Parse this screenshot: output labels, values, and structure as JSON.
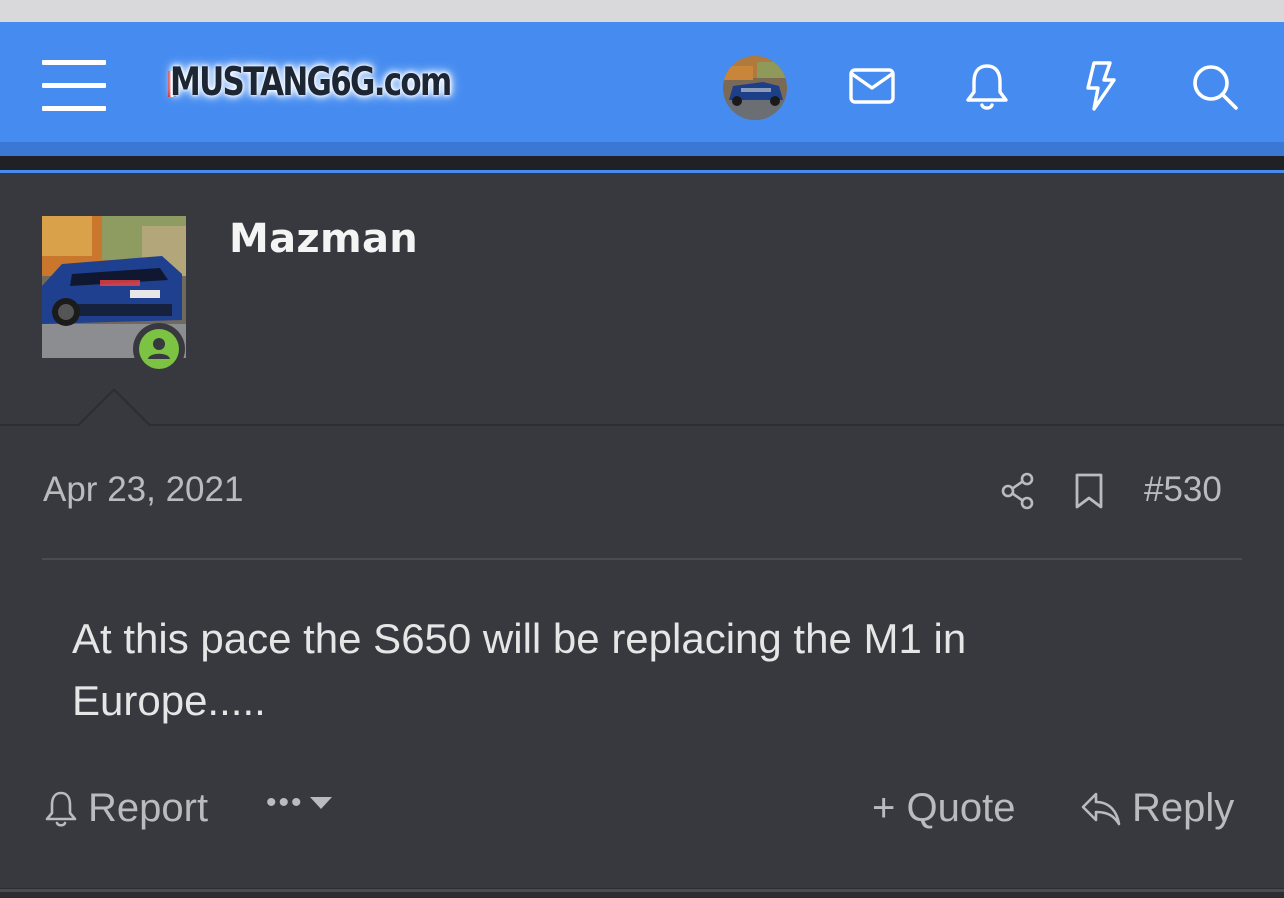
{
  "site": {
    "logo_text": "MUSTANG6G.com"
  },
  "post": {
    "username": "Mazman",
    "date": "Apr 23, 2021",
    "post_number": "#530",
    "body_line1": "At this pace the S650 will be replacing the M1 in",
    "body_line2": "Europe....."
  },
  "actions": {
    "report_label": "Report",
    "more_label": "•••",
    "quote_label": "+ Quote",
    "reply_label": "Reply"
  },
  "icons": {
    "menu": "hamburger-icon",
    "inbox": "envelope-icon",
    "alerts": "bell-icon",
    "whats_new": "lightning-bolt-icon",
    "search": "search-icon",
    "share": "share-icon",
    "bookmark": "bookmark-icon",
    "report": "bell-icon",
    "more": "caret-down-icon",
    "reply": "reply-arrow-icon",
    "online": "user-online-icon"
  },
  "colors": {
    "navbar": "#468cf0",
    "background": "#37393e",
    "online": "#7cc243"
  }
}
